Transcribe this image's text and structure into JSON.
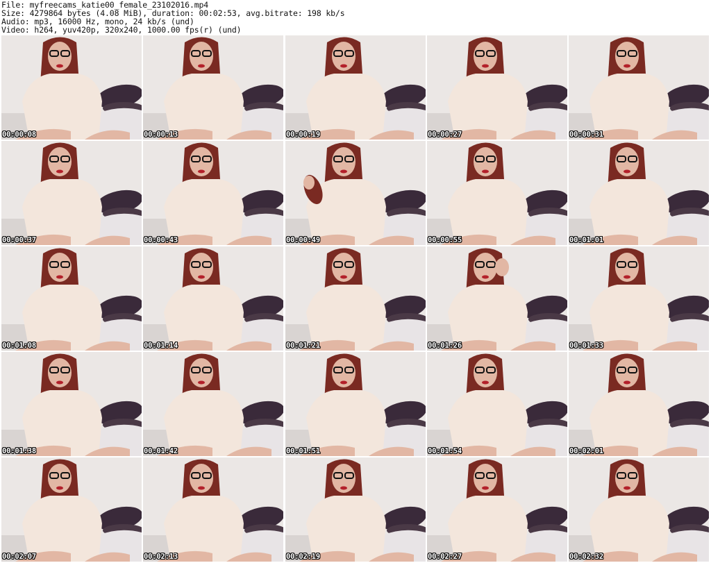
{
  "header": {
    "file_line": "File: myfreecams_katie00_female_23102016.mp4",
    "size_line": "Size: 4279864 bytes (4.08 MiB), duration: 00:02:53, avg.bitrate: 198 kb/s",
    "audio_line": "Audio: mp3, 16000 Hz, mono, 24 kb/s (und)",
    "video_line": "Video: h264, yuv420p, 320x240, 1000.00 fps(r) (und)"
  },
  "thumbnails": [
    {
      "timestamp": "00:00:08",
      "variant": "normal"
    },
    {
      "timestamp": "00:00:13",
      "variant": "normal"
    },
    {
      "timestamp": "00:00:19",
      "variant": "normal"
    },
    {
      "timestamp": "00:00:27",
      "variant": "normal"
    },
    {
      "timestamp": "00:00:31",
      "variant": "normal"
    },
    {
      "timestamp": "00:00:37",
      "variant": "normal"
    },
    {
      "timestamp": "00:00:43",
      "variant": "normal"
    },
    {
      "timestamp": "00:00:49",
      "variant": "hair"
    },
    {
      "timestamp": "00:00:55",
      "variant": "normal"
    },
    {
      "timestamp": "00:01:01",
      "variant": "normal"
    },
    {
      "timestamp": "00:01:08",
      "variant": "normal"
    },
    {
      "timestamp": "00:01:14",
      "variant": "normal"
    },
    {
      "timestamp": "00:01:21",
      "variant": "normal"
    },
    {
      "timestamp": "00:01:26",
      "variant": "hand"
    },
    {
      "timestamp": "00:01:33",
      "variant": "normal"
    },
    {
      "timestamp": "00:01:38",
      "variant": "normal"
    },
    {
      "timestamp": "00:01:42",
      "variant": "normal"
    },
    {
      "timestamp": "00:01:51",
      "variant": "normal"
    },
    {
      "timestamp": "00:01:54",
      "variant": "normal"
    },
    {
      "timestamp": "00:02:01",
      "variant": "normal"
    },
    {
      "timestamp": "00:02:07",
      "variant": "normal"
    },
    {
      "timestamp": "00:02:13",
      "variant": "normal"
    },
    {
      "timestamp": "00:02:19",
      "variant": "normal"
    },
    {
      "timestamp": "00:02:27",
      "variant": "normal"
    },
    {
      "timestamp": "00:02:32",
      "variant": "normal"
    }
  ],
  "colors": {
    "wall": "#ebe7e5",
    "shirt": "#f3e6dc",
    "hair": "#7a2a22",
    "skin": "#e2b7a4",
    "pillow": "#3a2a3a",
    "timestamp_text": "#ffffff"
  }
}
